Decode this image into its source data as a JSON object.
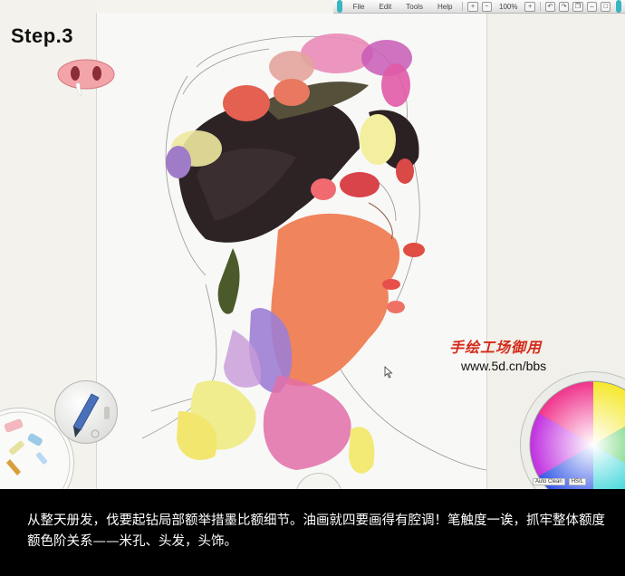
{
  "step_label": "Step.3",
  "toolbar": {
    "menu": [
      "File",
      "Edit",
      "Tools",
      "Help"
    ],
    "zoom_level": "100%",
    "zoom_in": "+",
    "zoom_out": "−"
  },
  "watermark": {
    "brand": "手绘工场御用",
    "url": "www.5d.cn/bbs"
  },
  "color_picker": {
    "auto_clean": "Auto Clean",
    "mode": "HS/L"
  },
  "caption": "从整天册发，伐要起钻局部额举措墨比额细节。油画就四要画得有腔调！笔触度一诶，抓牢整体额度额色阶关系——米孔、头发，头饰。",
  "colors": {
    "accent": "#3ab4c0",
    "watermark_red": "#d42a1a"
  }
}
